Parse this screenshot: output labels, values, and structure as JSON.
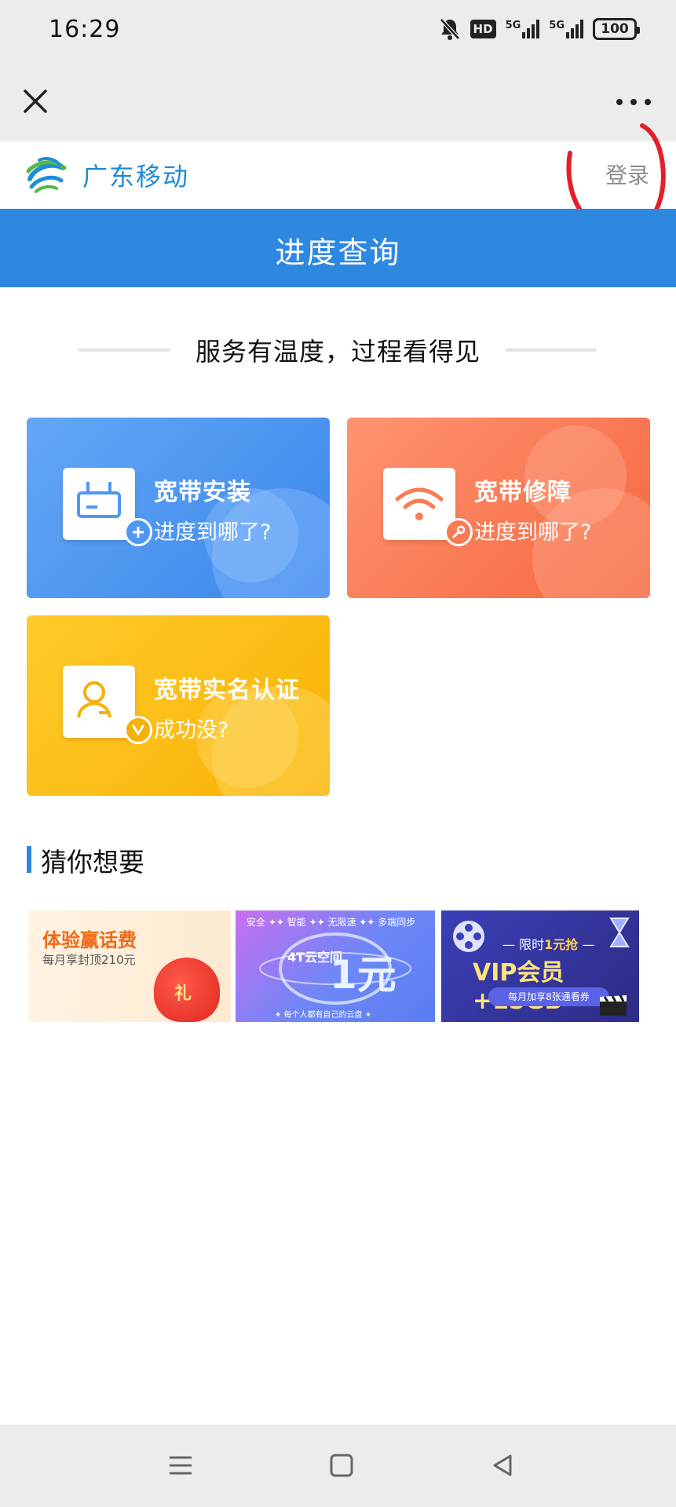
{
  "status_bar": {
    "time": "16:29",
    "hd_label": "HD",
    "signal1_label": "5G",
    "signal2_label": "5G",
    "battery_level": "100"
  },
  "header": {
    "brand_name": "广东移动",
    "login_label": "登录"
  },
  "title_bar": {
    "title": "进度查询"
  },
  "slogan": "服务有温度，过程看得见",
  "cards": [
    {
      "title": "宽带安装",
      "subtitle": "进度到哪了?",
      "color": "#4f97f0",
      "icon": "router-plus-icon"
    },
    {
      "title": "宽带修障",
      "subtitle": "进度到哪了?",
      "color": "#f97b54",
      "icon": "wifi-wrench-icon"
    },
    {
      "title": "宽带实名认证",
      "subtitle": "成功没?",
      "color": "#fbbd14",
      "icon": "user-check-icon"
    }
  ],
  "section": {
    "title": "猜你想要"
  },
  "banners": [
    {
      "headline": "体验赢话费",
      "sub": "每月享封顶210元",
      "bag_text": "礼"
    },
    {
      "top": "安全 ✦✦ 智能 ✦✦ 无限速 ✦✦ 多端同步",
      "big": "1元",
      "small": "4T云空间",
      "bottom": "✦ 每个人都有自己的云盘 ✦"
    },
    {
      "top_prefix": "— 限时",
      "top_highlight": "1元抢",
      "top_suffix": " —",
      "big": "VIP会员+15GB",
      "pill": "每月加享8张通看券"
    }
  ],
  "colors": {
    "brand_blue": "#2e88e0",
    "brand_text": "#1f8bd6",
    "annotation_red": "#e3202a"
  }
}
